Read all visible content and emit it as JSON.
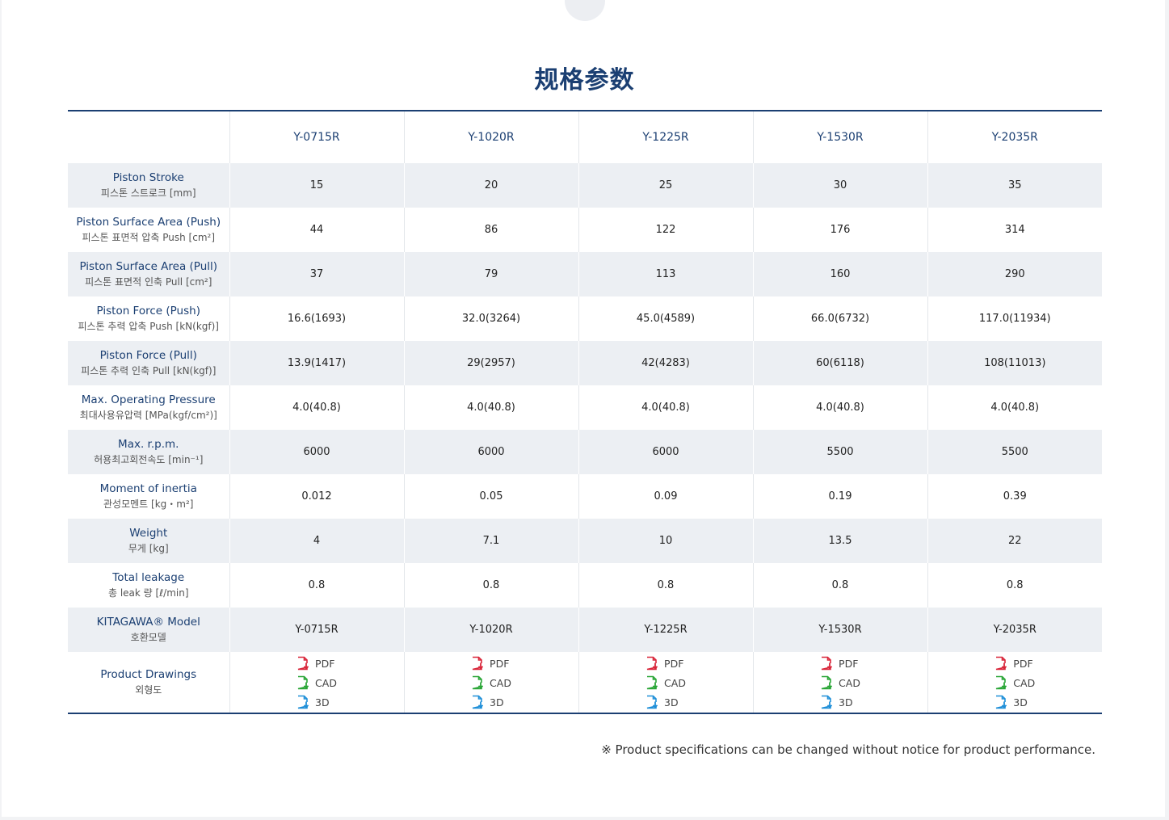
{
  "title": "规格参数",
  "models": [
    "Y-0715R",
    "Y-1020R",
    "Y-1225R",
    "Y-1530R",
    "Y-2035R"
  ],
  "rows": [
    {
      "en": "Piston Stroke",
      "ko": "피스톤 스트로크 [mm]",
      "values": [
        "15",
        "20",
        "25",
        "30",
        "35"
      ]
    },
    {
      "en": "Piston Surface Area (Push)",
      "ko": "피스톤 표면적 압축 Push [cm²]",
      "values": [
        "44",
        "86",
        "122",
        "176",
        "314"
      ]
    },
    {
      "en": "Piston Surface Area (Pull)",
      "ko": "피스톤 표면적 인축 Pull [cm²]",
      "values": [
        "37",
        "79",
        "113",
        "160",
        "290"
      ]
    },
    {
      "en": "Piston Force (Push)",
      "ko": "피스톤 추력 압축 Push [kN(kgf)]",
      "values": [
        "16.6(1693)",
        "32.0(3264)",
        "45.0(4589)",
        "66.0(6732)",
        "117.0(11934)"
      ]
    },
    {
      "en": "Piston Force (Pull)",
      "ko": "피스톤 추력 인축 Pull [kN(kgf)]",
      "values": [
        "13.9(1417)",
        "29(2957)",
        "42(4283)",
        "60(6118)",
        "108(11013)"
      ]
    },
    {
      "en": "Max. Operating Pressure",
      "ko": "최대사용유압력 [MPa(kgf/cm²)]",
      "values": [
        "4.0(40.8)",
        "4.0(40.8)",
        "4.0(40.8)",
        "4.0(40.8)",
        "4.0(40.8)"
      ]
    },
    {
      "en": "Max. r.p.m.",
      "ko": "허용최고회전속도 [min⁻¹]",
      "values": [
        "6000",
        "6000",
        "6000",
        "5500",
        "5500"
      ]
    },
    {
      "en": "Moment of inertia",
      "ko": "관성모멘트 [kg・m²]",
      "values": [
        "0.012",
        "0.05",
        "0.09",
        "0.19",
        "0.39"
      ]
    },
    {
      "en": "Weight",
      "ko": "무게 [kg]",
      "values": [
        "4",
        "7.1",
        "10",
        "13.5",
        "22"
      ]
    },
    {
      "en": "Total leakage",
      "ko": "총 leak 량 [ℓ/min]",
      "values": [
        "0.8",
        "0.8",
        "0.8",
        "0.8",
        "0.8"
      ]
    },
    {
      "en": "KITAGAWA® Model",
      "ko": "호환모델",
      "values": [
        "Y-0715R",
        "Y-1020R",
        "Y-1225R",
        "Y-1530R",
        "Y-2035R"
      ]
    }
  ],
  "drawings": {
    "en": "Product Drawings",
    "ko": "외형도",
    "links": [
      {
        "label": "PDF",
        "icon": "pdf-download-icon",
        "color": "#d9263a"
      },
      {
        "label": "CAD",
        "icon": "cad-download-icon",
        "color": "#2aa637"
      },
      {
        "label": "3D",
        "icon": "3d-download-icon",
        "color": "#1f8fd8"
      }
    ]
  },
  "note": "※ Product specifications can be changed without notice for product performance.",
  "colors": {
    "accent": "#1b3f72",
    "shade": "#eceff3"
  }
}
